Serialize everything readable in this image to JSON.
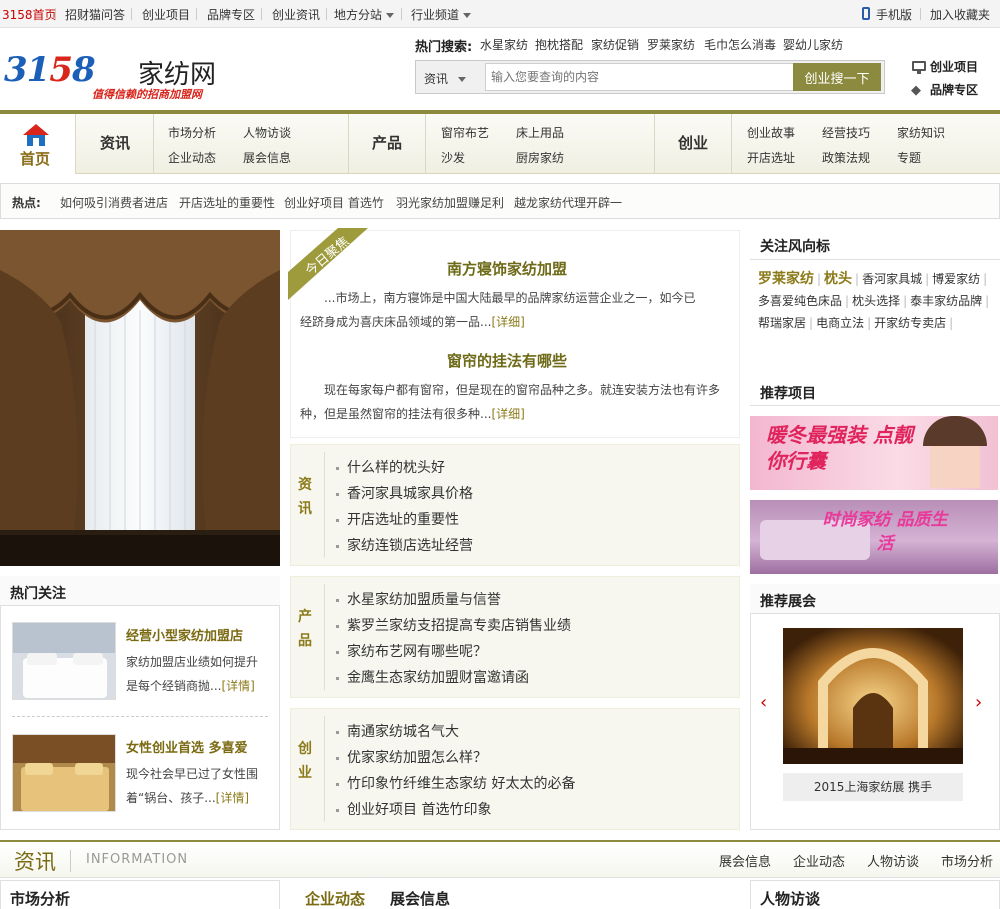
{
  "topbar": {
    "home": "3158首页",
    "items": [
      "招财猫问答",
      "创业项目",
      "品牌专区",
      "创业资讯",
      "地方分站",
      "行业频道"
    ],
    "mobile": "手机版",
    "favorite": "加入收藏夹"
  },
  "logo": {
    "number": "3158",
    "name": "家纺网",
    "slogan": "值得信赖的招商加盟网"
  },
  "search": {
    "hot_label": "热门搜索:",
    "hot_keywords": [
      "水星家纺",
      "抱枕搭配",
      "家纺促销",
      "罗莱家纺",
      "毛巾怎么消毒",
      "婴幼儿家纺"
    ],
    "category": "资讯",
    "placeholder": "输入您要查询的内容",
    "button": "创业搜一下"
  },
  "header_links": {
    "projects": "创业项目",
    "brands": "品牌专区"
  },
  "nav": {
    "home": "首页",
    "groups": [
      {
        "label": "资讯",
        "subs": [
          "市场分析",
          "人物访谈",
          "企业动态",
          "展会信息"
        ]
      },
      {
        "label": "产品",
        "subs": [
          "窗帘布艺",
          "床上用品",
          "沙发",
          "厨房家纺"
        ]
      },
      {
        "label": "创业",
        "subs": [
          "创业故事",
          "经营技巧",
          "家纺知识",
          "开店选址",
          "政策法规",
          "专题"
        ]
      }
    ]
  },
  "hotspot": {
    "label": "热点:",
    "items": [
      "如何吸引消费者进店",
      "开店选址的重要性",
      "创业好项目 首选竹",
      "羽光家纺加盟赚足利",
      "越龙家纺代理开辟一"
    ]
  },
  "hot_focus": {
    "title": "热门关注",
    "items": [
      {
        "title": "经营小型家纺加盟店",
        "line1": "家纺加盟店业绩如何提升",
        "line2": "是每个经销商抛...",
        "more": "[详情]"
      },
      {
        "title": "女性创业首选 多喜爱",
        "line1": "现今社会早已过了女性围",
        "line2": "着“锅台、孩子...",
        "more": "[详情]"
      }
    ]
  },
  "focus": {
    "ribbon": "今日聚焦",
    "articles": [
      {
        "title": "南方寝饰家纺加盟",
        "line1": "...市场上，南方寝饰是中国大陆最早的品牌家纺运营企业之一，如今已",
        "line2": "经跻身成为喜庆床品领域的第一品...",
        "more": "[详细]"
      },
      {
        "title": "窗帘的挂法有哪些",
        "line1": "现在每家每户都有窗帘，但是现在的窗帘品种之多。就连安装方法也有许多",
        "line2": "种，但是虽然窗帘的挂法有很多种...",
        "more": "[详细]"
      }
    ]
  },
  "blocks": [
    {
      "label": "资讯",
      "items": [
        "什么样的枕头好",
        "香河家具城家具价格",
        "开店选址的重要性",
        "家纺连锁店选址经营"
      ]
    },
    {
      "label": "产品",
      "items": [
        "水星家纺加盟质量与信誉",
        "紫罗兰家纺支招提高专卖店销售业绩",
        "家纺布艺网有哪些呢？",
        "金鹰生态家纺加盟财富邀请函"
      ]
    },
    {
      "label": "创业",
      "items": [
        "南通家纺城名气大",
        "优家家纺加盟怎么样？",
        "竹印象竹纤维生态家纺 好太太的必备",
        "创业好项目 首选竹印象"
      ]
    }
  ],
  "trend": {
    "title": "关注风向标",
    "big_tags": [
      "罗莱家纺",
      "枕头"
    ],
    "tags": [
      "香河家具城",
      "博爱家纺",
      "多喜爱纯色床品",
      "枕头选择",
      "泰丰家纺品牌",
      "帮瑞家居",
      "电商立法",
      "开家纺专卖店"
    ]
  },
  "recommend": {
    "title": "推荐项目",
    "ad1": "暖冬最强装 点靓你行囊",
    "ad2": "时尚家纺 品质生活"
  },
  "expo": {
    "title": "推荐展会",
    "caption": "2015上海家纺展 携手"
  },
  "info_section": {
    "title": "资讯",
    "en": "INFORMATION",
    "links": [
      "展会信息",
      "企业动态",
      "人物访谈",
      "市场分析"
    ]
  },
  "bottom": {
    "market": "市场分析",
    "company_tab": "企业动态",
    "expo_tab": "展会信息",
    "people": "人物访谈"
  }
}
